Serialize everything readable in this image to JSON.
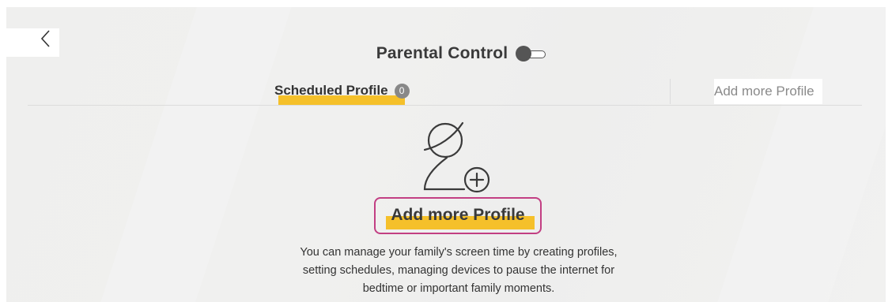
{
  "header": {
    "back_icon": "chevron-left-icon",
    "title": "Parental Control",
    "toggle_state": "off"
  },
  "tabs": {
    "scheduled_label": "Scheduled Profile",
    "scheduled_count": "0",
    "add_label": "Add more Profile"
  },
  "empty_state": {
    "icon": "add-user-icon",
    "button_label": "Add more Profile",
    "description_lines": [
      "You can manage your family's screen time by creating profiles,",
      "setting schedules, managing devices to pause the internet for",
      "bedtime or important family moments."
    ]
  },
  "colors": {
    "highlight": "#f5c02a",
    "button_border": "#c23f83",
    "text": "#333333"
  }
}
